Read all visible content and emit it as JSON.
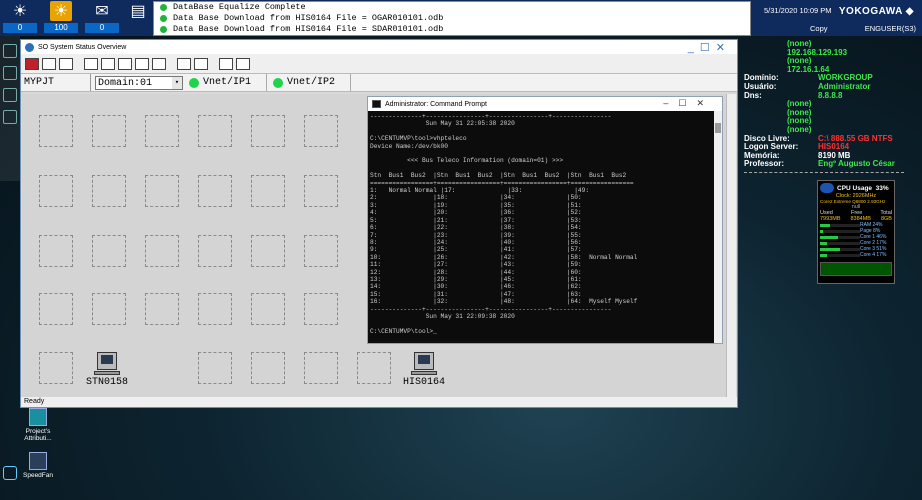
{
  "topbar": {
    "buttons": [
      {
        "icon": "sun-alarm-icon",
        "count": "0"
      },
      {
        "icon": "sun-alarm-active-icon",
        "count": "100"
      },
      {
        "icon": "operator-guide-icon",
        "count": "0"
      },
      {
        "icon": "message-icon",
        "count": ""
      }
    ],
    "messages": [
      "DataBase Equalize Complete",
      "Data Base Download from HIS0164 File = OGAR010101.odb",
      "Data Base Download from HIS0164 File = SDAR010101.odb"
    ],
    "clock": "5/31/2020 10:09 PM",
    "brand": "YOKOGAWA ◆",
    "copy_label": "Copy",
    "user": "ENGUSER(S3)"
  },
  "window": {
    "title": "SO System Status Overview",
    "project": "MYPJT",
    "domain": "Domain:01",
    "vnet1": "Vnet/IP1",
    "vnet2": "Vnet/IP2",
    "stations": [
      "STN0158",
      "HIS0164"
    ],
    "status": "Ready"
  },
  "cmd": {
    "title": "Administrator: Command Prompt",
    "lines": [
      "--------------+----------------+----------------+----------------",
      "               Sun May 31 22:05:38 2020",
      "",
      "C:\\CENTUMVP\\tool>vhpteleco",
      "Device Name:/dev/bk00",
      "",
      "          <<< Bus Teleco Information (domain=01) >>>",
      "",
      "Stn  Bus1  Bus2  |Stn  Bus1  Bus2  |Stn  Bus1  Bus2  |Stn  Bus1  Bus2",
      "=================+=================+=================+=================",
      "1:   Normal Normal |17:              |33:              |49:",
      "2:               |18:              |34:              |50:",
      "3:               |19:              |35:              |51:",
      "4:               |20:              |36:              |52:",
      "5:               |21:              |37:              |53:",
      "6:               |22:              |38:              |54:",
      "7:               |23:              |39:              |55:",
      "8:               |24:              |40:              |56:",
      "9:               |25:              |41:              |57:",
      "10:              |26:              |42:              |58:  Normal Normal",
      "11:              |27:              |43:              |59:",
      "12:              |28:              |44:              |60:",
      "13:              |29:              |45:              |61:",
      "14:              |30:              |46:              |62:",
      "15:              |31:              |47:              |63:",
      "16:              |32:              |48:              |64:  Myself Myself",
      "--------------+----------------+----------------+----------------",
      "               Sun May 31 22:09:38 2020",
      "",
      "C:\\CENTUMVP\\tool>_"
    ]
  },
  "info": {
    "ips": [
      "(none)",
      "192.168.129.193",
      "(none)",
      "172.16.1.64"
    ],
    "dominio_label": "Domínio:",
    "dominio": "WORKGROUP",
    "usuario_label": "Usuário:",
    "usuario": "Administrator",
    "dns_label": "Dns:",
    "dns": [
      "8.8.8.8",
      "(none)",
      "(none)",
      "(none)",
      "(none)"
    ],
    "disco_label": "Disco Livre:",
    "disco": "C:\\ 888.55 GB NTFS",
    "logon_label": "Logon Server:",
    "logon": "HIS0164",
    "memoria_label": "Memória:",
    "memoria": "8190 MB",
    "professor_label": "Professor:",
    "professor": "Engº Augusto César"
  },
  "cpu": {
    "title": "CPU Usage",
    "percent": "33%",
    "clock": "Clock: 2926MHz",
    "model": "Core2 Extreme Q6800 2.93GHz",
    "null": "null",
    "mem_headers": [
      "Used",
      "Free",
      "Total"
    ],
    "mem_values": [
      "7993MB",
      "8384MB",
      "8GB"
    ],
    "cores": [
      {
        "label": "RAM",
        "pct": "24%",
        "fill": 0.24
      },
      {
        "label": "Page",
        "pct": "8%",
        "fill": 0.08
      },
      {
        "label": "Core 1",
        "pct": "46%",
        "fill": 0.46
      },
      {
        "label": "Core 2",
        "pct": "17%",
        "fill": 0.17
      },
      {
        "label": "Core 3",
        "pct": "51%",
        "fill": 0.51
      },
      {
        "label": "Core 4",
        "pct": "17%",
        "fill": 0.17
      }
    ]
  },
  "desktop": {
    "icons": [
      "Project's Attributi...",
      "SpeedFan"
    ]
  }
}
